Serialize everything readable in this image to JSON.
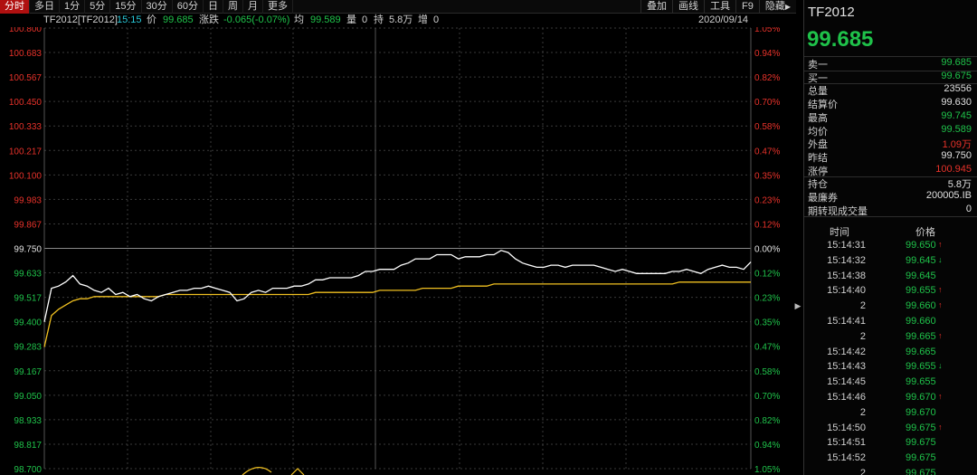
{
  "colors": {
    "up": "#e8322a",
    "down": "#1fc24a",
    "neutral": "#e0e0e0",
    "avg_line": "#f0c020",
    "grid": "#3a3a3a"
  },
  "toolbar": {
    "timeframes": [
      "分时",
      "多日",
      "1分",
      "5分",
      "15分",
      "30分",
      "60分",
      "日",
      "周",
      "月",
      "更多"
    ],
    "active_timeframe": "分时",
    "tools": [
      "叠加",
      "画线",
      "工具",
      "F9",
      "隐藏"
    ]
  },
  "infobar": {
    "symbol": "TF2012[TF2012]",
    "time": "15:15",
    "price_label": "价",
    "price": "99.685",
    "change_label": "涨跌",
    "change": "-0.065(-0.07%)",
    "avg_label": "均",
    "avg": "99.589",
    "vol_label": "量",
    "vol": "0",
    "oi_label": "持",
    "oi": "5.8万",
    "inc_label": "增",
    "inc": "0",
    "date": "2020/09/14"
  },
  "chart_data": {
    "type": "line",
    "ylim": [
      98.7,
      100.8
    ],
    "base_price": 99.75,
    "y_ticks_left": [
      "100.800",
      "100.683",
      "100.567",
      "100.450",
      "100.333",
      "100.217",
      "100.100",
      "99.983",
      "99.867",
      "99.750",
      "99.633",
      "99.517",
      "99.400",
      "99.283",
      "99.167",
      "99.050",
      "98.933",
      "98.817",
      "98.700"
    ],
    "y_ticks_right": [
      "1.05%",
      "0.94%",
      "0.82%",
      "0.70%",
      "0.58%",
      "0.47%",
      "0.35%",
      "0.23%",
      "0.12%",
      "0.00%",
      "0.12%",
      "0.23%",
      "0.35%",
      "0.47%",
      "0.58%",
      "0.70%",
      "0.82%",
      "0.94%",
      "1.05%"
    ],
    "series": [
      {
        "values": [
          99.4,
          99.56,
          99.57,
          99.59,
          99.62,
          99.58,
          99.57,
          99.55,
          99.54,
          99.56,
          99.53,
          99.54,
          99.52,
          99.53,
          99.51,
          99.5,
          99.52,
          99.53,
          99.54,
          99.55,
          99.55,
          99.56,
          99.56,
          99.57,
          99.56,
          99.55,
          99.54,
          99.5,
          99.51,
          99.54,
          99.55,
          99.54,
          99.56,
          99.56,
          99.56,
          99.57,
          99.57,
          99.58,
          99.6,
          99.6,
          99.61,
          99.61,
          99.61,
          99.61,
          99.62,
          99.64,
          99.64,
          99.65,
          99.65,
          99.65,
          99.67,
          99.68,
          99.7,
          99.7,
          99.7,
          99.72,
          99.72,
          99.72,
          99.7,
          99.71,
          99.71,
          99.71,
          99.72,
          99.72,
          99.74,
          99.73,
          99.7,
          99.68,
          99.67,
          99.66,
          99.66,
          99.67,
          99.67,
          99.66,
          99.67,
          99.67,
          99.67,
          99.67,
          99.66,
          99.65,
          99.64,
          99.65,
          99.64,
          99.63,
          99.63,
          99.63,
          99.63,
          99.63,
          99.64,
          99.64,
          99.65,
          99.64,
          99.63,
          99.65,
          99.66,
          99.67,
          99.66,
          99.66,
          99.65,
          99.685
        ]
      },
      {
        "values": [
          99.28,
          99.43,
          99.46,
          99.48,
          99.5,
          99.51,
          99.51,
          99.52,
          99.52,
          99.52,
          99.52,
          99.52,
          99.52,
          99.52,
          99.52,
          99.52,
          99.52,
          99.53,
          99.53,
          99.53,
          99.53,
          99.53,
          99.53,
          99.53,
          99.53,
          99.53,
          99.53,
          99.53,
          99.53,
          99.53,
          99.53,
          99.53,
          99.53,
          99.53,
          99.53,
          99.53,
          99.53,
          99.53,
          99.54,
          99.54,
          99.54,
          99.54,
          99.54,
          99.54,
          99.54,
          99.54,
          99.54,
          99.55,
          99.55,
          99.55,
          99.55,
          99.55,
          99.55,
          99.56,
          99.56,
          99.56,
          99.56,
          99.56,
          99.57,
          99.57,
          99.57,
          99.57,
          99.57,
          99.58,
          99.58,
          99.58,
          99.58,
          99.58,
          99.58,
          99.58,
          99.58,
          99.58,
          99.58,
          99.58,
          99.58,
          99.58,
          99.58,
          99.58,
          99.58,
          99.58,
          99.58,
          99.58,
          99.58,
          99.58,
          99.58,
          99.58,
          99.58,
          99.58,
          99.58,
          99.589,
          99.589,
          99.589,
          99.589,
          99.589,
          99.589,
          99.589,
          99.589,
          99.589,
          99.589,
          99.589
        ]
      }
    ]
  },
  "panel": {
    "symbol": "TF2012",
    "price": "99.685",
    "quotes": [
      {
        "label": "卖一",
        "value": "99.685",
        "color": "green",
        "sep": true
      },
      {
        "label": "买一",
        "value": "99.675",
        "color": "green",
        "sep": true
      },
      {
        "label": "总量",
        "value": "23556",
        "color": "white"
      },
      {
        "label": "结算价",
        "value": "99.630",
        "color": "white"
      },
      {
        "label": "最高",
        "value": "99.745",
        "color": "green"
      },
      {
        "label": "均价",
        "value": "99.589",
        "color": "green"
      },
      {
        "label": "外盘",
        "value": "1.09万",
        "color": "red"
      },
      {
        "label": "昨结",
        "value": "99.750",
        "color": "white"
      },
      {
        "label": "涨停",
        "value": "100.945",
        "color": "red",
        "sep": true
      },
      {
        "label": "持仓",
        "value": "5.8万",
        "color": "white"
      },
      {
        "label": "最廉券",
        "value": "200005.IB",
        "color": "white",
        "label_color": "yellow"
      },
      {
        "label": "期转现成交量",
        "value": "0",
        "color": "white",
        "sep": true
      }
    ],
    "ticks_header": {
      "time": "时间",
      "price": "价格"
    },
    "ticks": [
      {
        "time": "15:14:31",
        "price": "99.650",
        "arrow": "↑",
        "arrow_color": "red"
      },
      {
        "time": "15:14:32",
        "price": "99.645",
        "arrow": "↓",
        "arrow_color": "green"
      },
      {
        "time": "15:14:38",
        "price": "99.645",
        "arrow": "",
        "arrow_color": "green"
      },
      {
        "time": "15:14:40",
        "price": "99.655",
        "arrow": "↑",
        "arrow_color": "red"
      },
      {
        "time": "2",
        "price": "99.660",
        "arrow": "↑",
        "arrow_color": "red"
      },
      {
        "time": "15:14:41",
        "price": "99.660",
        "arrow": "",
        "arrow_color": "red"
      },
      {
        "time": "2",
        "price": "99.665",
        "arrow": "↑",
        "arrow_color": "red"
      },
      {
        "time": "15:14:42",
        "price": "99.665",
        "arrow": "",
        "arrow_color": "red"
      },
      {
        "time": "15:14:43",
        "price": "99.655",
        "arrow": "↓",
        "arrow_color": "green"
      },
      {
        "time": "15:14:45",
        "price": "99.655",
        "arrow": "",
        "arrow_color": "green"
      },
      {
        "time": "15:14:46",
        "price": "99.670",
        "arrow": "↑",
        "arrow_color": "red"
      },
      {
        "time": "2",
        "price": "99.670",
        "arrow": "",
        "arrow_color": "red"
      },
      {
        "time": "15:14:50",
        "price": "99.675",
        "arrow": "↑",
        "arrow_color": "red"
      },
      {
        "time": "15:14:51",
        "price": "99.675",
        "arrow": "",
        "arrow_color": "red"
      },
      {
        "time": "15:14:52",
        "price": "99.675",
        "arrow": "",
        "arrow_color": "red"
      },
      {
        "time": "2",
        "price": "99.675",
        "arrow": "",
        "arrow_color": "red"
      }
    ]
  }
}
